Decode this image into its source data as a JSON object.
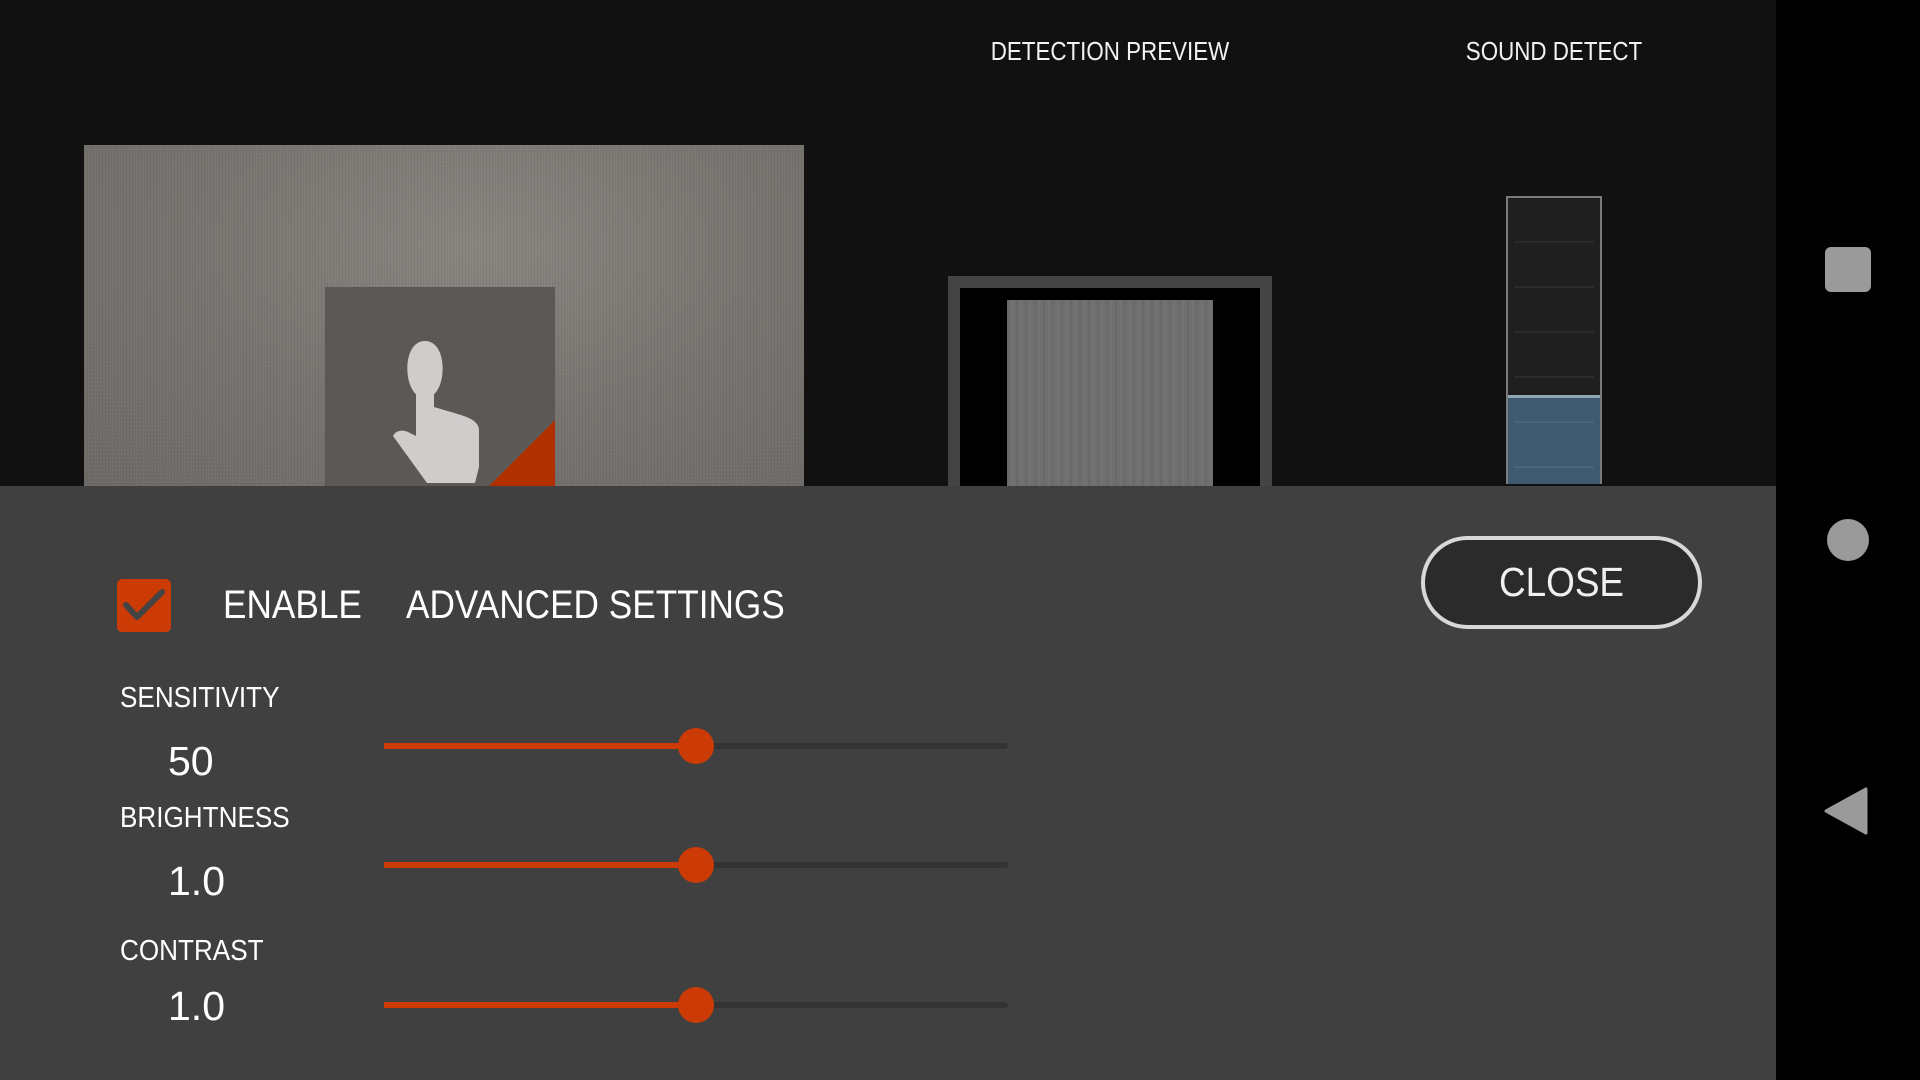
{
  "header": {
    "detection_preview_title": "DETECTION PREVIEW",
    "sound_detect_title": "SOUND DETECT"
  },
  "camera_preview": {
    "touch_icon": "touch-hand-icon",
    "corner_marker_color": "#b03000"
  },
  "sound_meter": {
    "level": 0.3,
    "segments": 6,
    "fill_color": "#3e5a70"
  },
  "settings": {
    "enable_checkbox_checked": true,
    "enable_label": "ENABLE",
    "advanced_label": "ADVANCED SETTINGS",
    "close_label": "CLOSE",
    "sliders": [
      {
        "label": "SENSITIVITY",
        "value": "50",
        "fraction": 0.5
      },
      {
        "label": "BRIGHTNESS",
        "value": "1.0",
        "fraction": 0.5
      },
      {
        "label": "CONTRAST",
        "value": "1.0",
        "fraction": 0.5
      }
    ],
    "accent_color": "#cc3a05"
  },
  "nav_bar": {
    "recent_icon": "square-recents-icon",
    "home_icon": "circle-home-icon",
    "back_icon": "triangle-back-icon"
  }
}
